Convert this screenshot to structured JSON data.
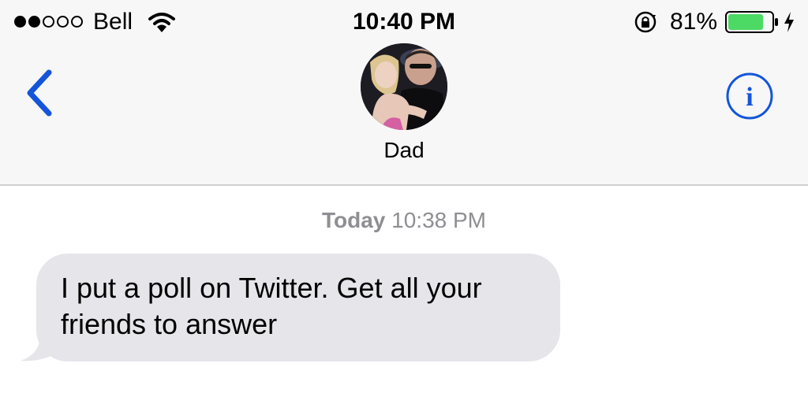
{
  "status_bar": {
    "signal_filled": 2,
    "signal_total": 5,
    "carrier": "Bell",
    "time": "10:40 PM",
    "battery_percent": "81%",
    "battery_level": 0.81,
    "battery_color": "#4cd964"
  },
  "nav": {
    "back_icon": "chevron-left-icon",
    "contact_name": "Dad",
    "info_icon": "info-icon",
    "accent_color": "#1455d9"
  },
  "conversation": {
    "timestamp_day": "Today",
    "timestamp_time": "10:38 PM",
    "messages": [
      {
        "direction": "incoming",
        "text": "I put a poll on Twitter. Get all your friends to answer"
      }
    ]
  }
}
